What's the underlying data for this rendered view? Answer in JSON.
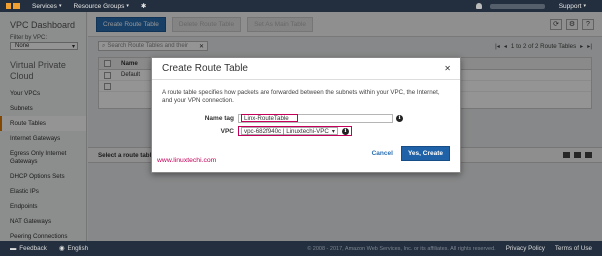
{
  "topnav": {
    "services": "Services",
    "resource_groups": "Resource Groups",
    "support": "Support"
  },
  "sidebar": {
    "title": "VPC Dashboard",
    "filter_label": "Filter by VPC:",
    "filter_value": "None",
    "section": "Virtual Private Cloud",
    "items": [
      {
        "label": "Your VPCs"
      },
      {
        "label": "Subnets"
      },
      {
        "label": "Route Tables"
      },
      {
        "label": "Internet Gateways"
      },
      {
        "label": "Egress Only Internet Gateways"
      },
      {
        "label": "DHCP Options Sets"
      },
      {
        "label": "Elastic IPs"
      },
      {
        "label": "Endpoints"
      },
      {
        "label": "NAT Gateways"
      },
      {
        "label": "Peering Connections"
      }
    ],
    "active_index": 2
  },
  "toolbar": {
    "create": "Create Route Table",
    "delete": "Delete Route Table",
    "set_main": "Set As Main Table"
  },
  "search": {
    "placeholder": "Search Route Tables and their"
  },
  "paging": {
    "text": "1 to 2 of 2 Route Tables"
  },
  "table": {
    "header_name": "Name",
    "rows": [
      "Default",
      ""
    ]
  },
  "detail": {
    "label": "Select a route table"
  },
  "modal": {
    "title": "Create Route Table",
    "description": "A route table specifies how packets are forwarded between the subnets within your VPC, the Internet, and your VPN connection.",
    "name_tag_label": "Name tag",
    "name_tag_value": "Linx-RouteTable",
    "vpc_label": "VPC",
    "vpc_value": "vpc-682f940c | Linuxtechi-VPC",
    "watermark": "www.linuxtechi.com",
    "cancel": "Cancel",
    "submit": "Yes, Create"
  },
  "footer": {
    "feedback": "Feedback",
    "language": "English",
    "copyright": "© 2008 - 2017, Amazon Web Services, Inc. or its affiliates. All rights reserved.",
    "privacy": "Privacy Policy",
    "terms": "Terms of Use"
  },
  "colors": {
    "nav_bg": "#232f3e",
    "primary_button": "#2a6eb2",
    "highlight": "#c4005a",
    "active_accent": "#e07b00"
  }
}
